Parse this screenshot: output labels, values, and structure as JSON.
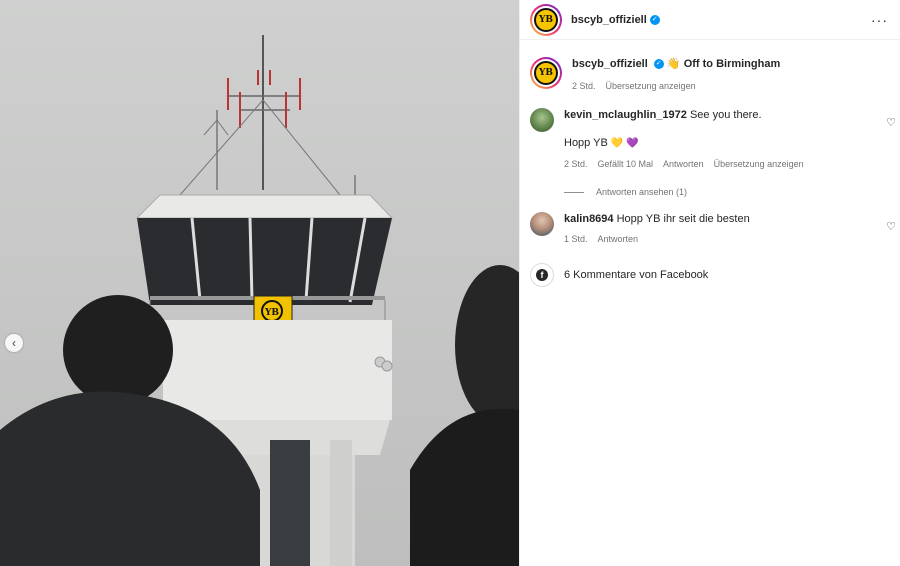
{
  "post": {
    "username": "bscyb_offiziell",
    "caption": "Off to Birmingham",
    "caption_emoji": "👋",
    "time": "2 Std.",
    "translate": "Übersetzung anzeigen"
  },
  "comments": [
    {
      "username": "kevin_mclaughlin_1972",
      "text": "See you there.",
      "text2": "Hopp YB",
      "emojis": "💛 💜",
      "time": "2 Std.",
      "likes": "Gefällt 10 Mal",
      "reply": "Antworten",
      "translate": "Übersetzung anzeigen",
      "view_replies": "Antworten ansehen (1)"
    },
    {
      "username": "kalin8694",
      "text": "Hopp YB ihr seit die besten",
      "time": "1 Std.",
      "reply": "Antworten"
    }
  ],
  "facebook": {
    "label": "6 Kommentare von Facebook"
  },
  "icons": {
    "verified": "verified-badge-icon",
    "more": "more-options-icon",
    "heart": "heart-icon",
    "facebook": "facebook-icon",
    "prev": "chevron-left-icon"
  },
  "colors": {
    "verified": "#0095f6",
    "yb_yellow": "#f6c500",
    "muted": "#737373"
  }
}
